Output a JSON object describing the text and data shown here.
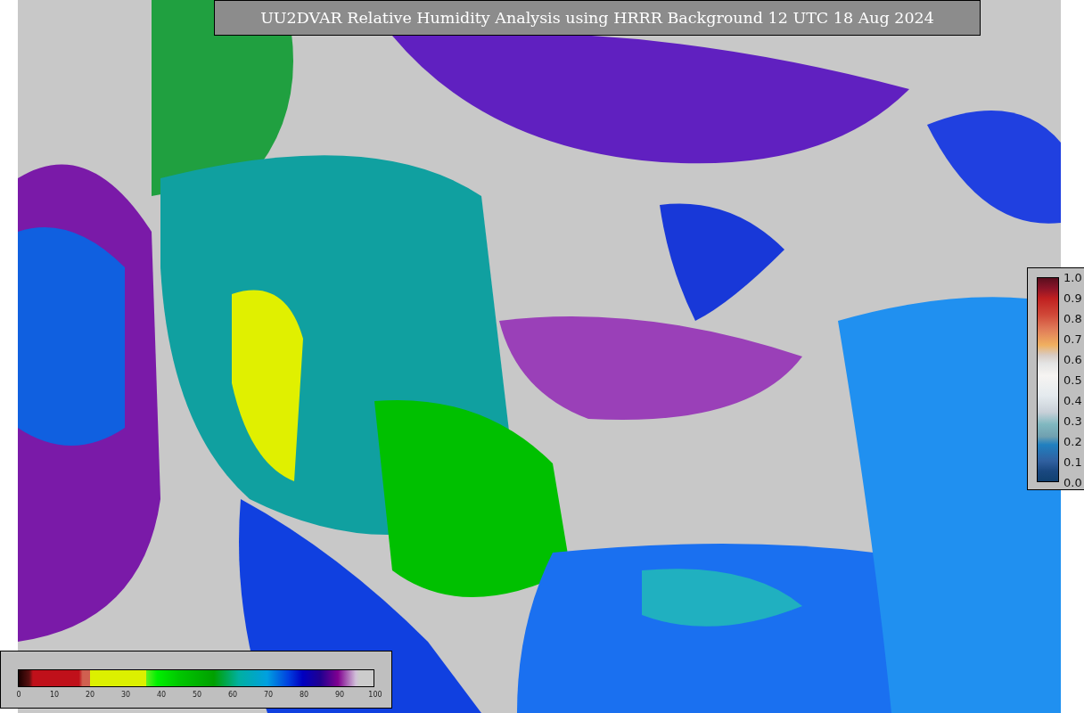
{
  "title": "UU2DVAR Relative Humidity Analysis using HRRR Background 12 UTC 18 Aug 2024",
  "humidity_colorbar": {
    "ticks": [
      "0",
      "10",
      "20",
      "30",
      "40",
      "50",
      "60",
      "70",
      "80",
      "90",
      "100"
    ]
  },
  "fraction_colorbar": {
    "ticks": [
      "1.0",
      "0.9",
      "0.8",
      "0.7",
      "0.6",
      "0.5",
      "0.4",
      "0.3",
      "0.2",
      "0.1",
      "0.0"
    ]
  }
}
